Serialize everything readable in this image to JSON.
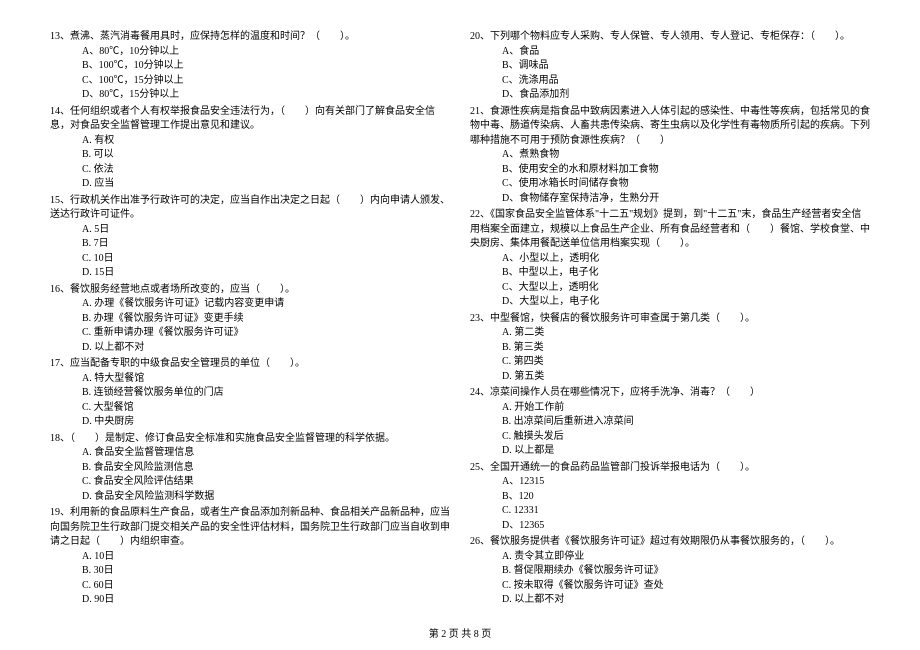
{
  "questions_left": [
    {
      "num": "13",
      "text": "煮沸、蒸汽消毒餐用具时，应保持怎样的温度和时间？（　　）。",
      "options": [
        "A、80℃，10分钟以上",
        "B、100℃，10分钟以上",
        "C、100℃，15分钟以上",
        "D、80℃，15分钟以上"
      ]
    },
    {
      "num": "14",
      "text": "任何组织或者个人有权举报食品安全违法行为，（　　）向有关部门了解食品安全信息，对食品安全监督管理工作提出意见和建议。",
      "options": [
        "A. 有权",
        "B. 可以",
        "C. 依法",
        "D. 应当"
      ]
    },
    {
      "num": "15",
      "text": "行政机关作出准予行政许可的决定，应当自作出决定之日起（　　）内向申请人颁发、送达行政许可证件。",
      "options": [
        "A. 5日",
        "B. 7日",
        "C. 10日",
        "D. 15日"
      ]
    },
    {
      "num": "16",
      "text": "餐饮服务经营地点或者场所改变的，应当（　　）。",
      "options": [
        "A. 办理《餐饮服务许可证》记载内容变更申请",
        "B. 办理《餐饮服务许可证》变更手续",
        "C. 重新申请办理《餐饮服务许可证》",
        "D. 以上都不对"
      ]
    },
    {
      "num": "17",
      "text": "应当配备专职的中级食品安全管理员的单位（　　）。",
      "options": [
        "A. 特大型餐馆",
        "B. 连锁经营餐饮服务单位的门店",
        "C. 大型餐馆",
        "D. 中央厨房"
      ]
    },
    {
      "num": "18",
      "text": "（　　）是制定、修订食品安全标准和实施食品安全监督管理的科学依据。",
      "options": [
        "A. 食品安全监督管理信息",
        "B. 食品安全风险监测信息",
        "C. 食品安全风险评估结果",
        "D. 食品安全风险监测科学数据"
      ]
    },
    {
      "num": "19",
      "text": "利用新的食品原料生产食品，或者生产食品添加剂新品种、食品相关产品新品种，应当向国务院卫生行政部门提交相关产品的安全性评估材料，国务院卫生行政部门应当自收到申请之日起（　　）内组织审查。",
      "options": [
        "A. 10日",
        "B. 30日",
        "C. 60日",
        "D. 90日"
      ]
    }
  ],
  "questions_right": [
    {
      "num": "20",
      "text": "下列哪个物料应专人采购、专人保管、专人领用、专人登记、专柜保存：（　　）。",
      "options": [
        "A、食品",
        "B、调味品",
        "C、洗涤用品",
        "D、食品添加剂"
      ]
    },
    {
      "num": "21",
      "text": "食源性疾病是指食品中致病因素进入人体引起的感染性、中毒性等疾病，包括常见的食物中毒、肠道传染病、人畜共患传染病、寄生虫病以及化学性有毒物质所引起的疾病。下列哪种措施不可用于预防食源性疾病？（　　）",
      "options": [
        "A、煮熟食物",
        "B、使用安全的水和原材料加工食物",
        "C、使用冰箱长时间储存食物",
        "D、食物储存室保持洁净，生熟分开"
      ]
    },
    {
      "num": "22",
      "text": "《国家食品安全监管体系\"十二五\"规划》提到，到\"十二五\"末，食品生产经营者安全信用档案全面建立，规模以上食品生产企业、所有食品经营者和（　　）餐馆、学校食堂、中央厨房、集体用餐配送单位信用档案实现（　　）。",
      "options": [
        "A、小型以上，透明化",
        "B、中型以上，电子化",
        "C、大型以上，透明化",
        "D、大型以上，电子化"
      ]
    },
    {
      "num": "23",
      "text": "中型餐馆，快餐店的餐饮服务许可审查属于第几类（　　）。",
      "options": [
        "A. 第二类",
        "B. 第三类",
        "C. 第四类",
        "D. 第五类"
      ]
    },
    {
      "num": "24",
      "text": "凉菜间操作人员在哪些情况下，应将手洗净、消毒？（　　）",
      "options": [
        "A. 开始工作前",
        "B. 出凉菜间后重新进入凉菜间",
        "C. 触摸头发后",
        "D. 以上都是"
      ]
    },
    {
      "num": "25",
      "text": "全国开通统一的食品药品监管部门投诉举报电话为（　　）。",
      "options": [
        "A、12315",
        "B、120",
        "C. 12331",
        "D、12365"
      ]
    },
    {
      "num": "26",
      "text": "餐饮服务提供者《餐饮服务许可证》超过有效期限仍从事餐饮服务的，（　　）。",
      "options": [
        "A. 责令其立即停业",
        "B. 督促限期续办《餐饮服务许可证》",
        "C. 按未取得《餐饮服务许可证》查处",
        "D. 以上都不对"
      ]
    }
  ],
  "footer": "第 2 页 共 8 页"
}
